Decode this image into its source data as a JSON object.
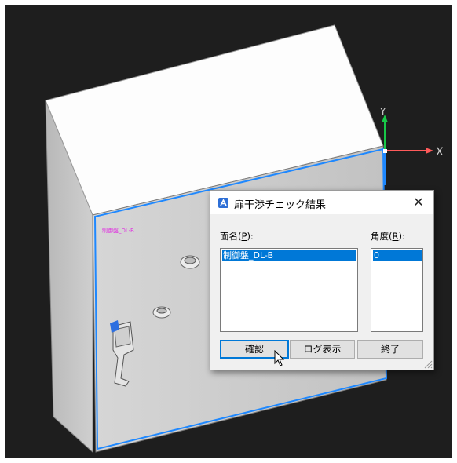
{
  "viewport": {
    "background": "#1e1e1e",
    "axis_x_label": "X",
    "axis_y_label": "Y",
    "face_marker_text": "制御盤_DL-B",
    "colors": {
      "selection": "#1e88ff",
      "x_axis": "#ff5a5a",
      "y_axis": "#18c848",
      "marker": "#e030e0"
    }
  },
  "dialog": {
    "title": "扉干渉チェック結果",
    "close_glyph": "✕",
    "face_label": "面名(",
    "face_label_key": "P",
    "face_label_end": "):",
    "angle_label": "角度(",
    "angle_label_key": "R",
    "angle_label_end": "):",
    "face_list": {
      "items": [
        "制御盤_DL-B"
      ],
      "selected_index": 0
    },
    "angle_list": {
      "items": [
        "0"
      ],
      "selected_index": 0
    },
    "buttons": {
      "confirm": "確認",
      "log": "ログ表示",
      "end": "終了"
    }
  }
}
